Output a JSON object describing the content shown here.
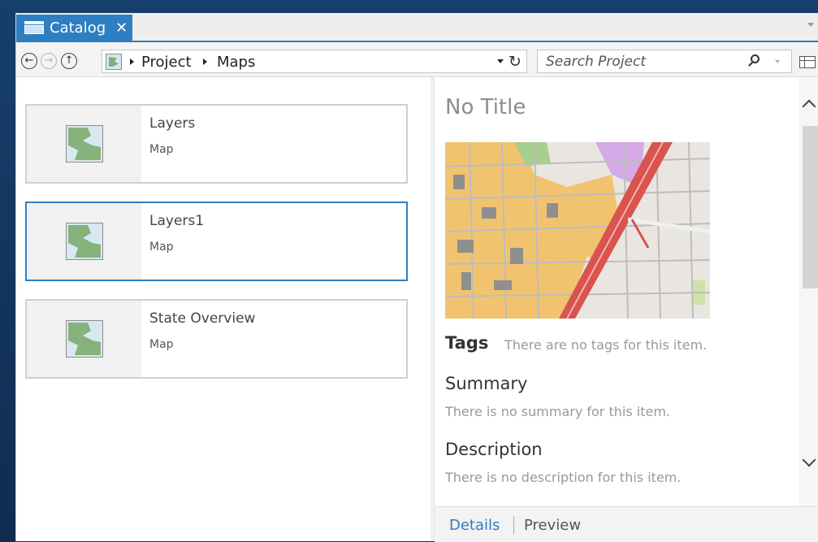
{
  "tab": {
    "label": "Catalog",
    "close": "✕"
  },
  "nav": {
    "back": "←",
    "forward": "→",
    "up": "↑"
  },
  "breadcrumb": {
    "items": [
      "Project",
      "Maps"
    ]
  },
  "refresh": "↻",
  "search": {
    "placeholder": "Search Project"
  },
  "items": [
    {
      "title": "Layers",
      "type": "Map"
    },
    {
      "title": "Layers1",
      "type": "Map"
    },
    {
      "title": "State Overview",
      "type": "Map"
    }
  ],
  "details": {
    "title": "No Title",
    "tags_label": "Tags",
    "tags_text": "There are no tags for this item.",
    "summary_heading": "Summary",
    "summary_text": "There is no summary for this item.",
    "description_heading": "Description",
    "description_text": "There is no description for this item."
  },
  "bottom_tabs": {
    "details": "Details",
    "preview": "Preview"
  },
  "colors": {
    "accent": "#2d7fc1",
    "desktop": "#12355f"
  }
}
